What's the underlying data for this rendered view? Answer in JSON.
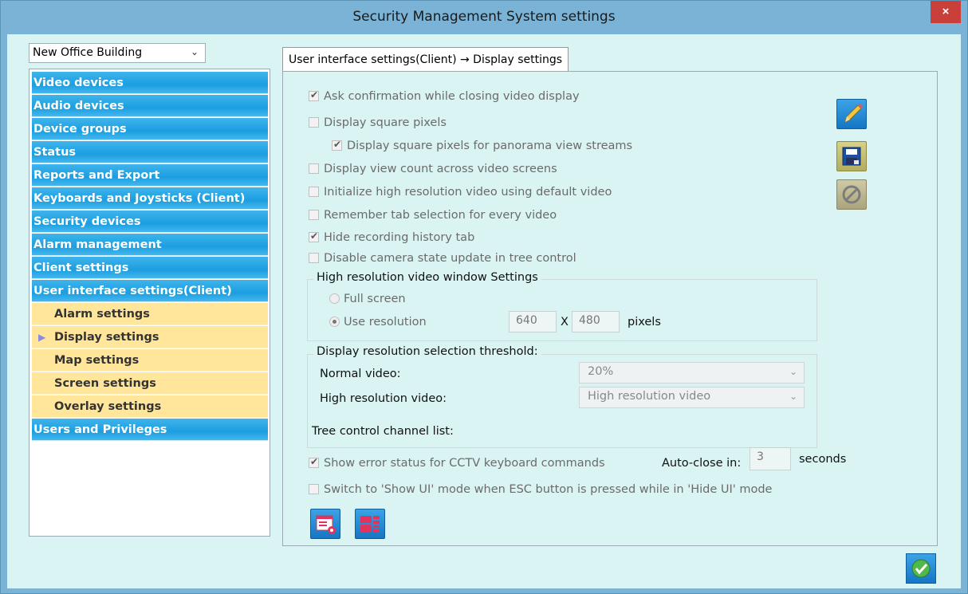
{
  "window": {
    "title": "Security Management System settings",
    "close_label": "×"
  },
  "location_select": {
    "value": "New Office Building"
  },
  "nav": {
    "items": [
      {
        "label": "Video devices"
      },
      {
        "label": "Audio devices"
      },
      {
        "label": "Device groups"
      },
      {
        "label": "Status"
      },
      {
        "label": "Reports and Export"
      },
      {
        "label": "Keyboards and Joysticks (Client)"
      },
      {
        "label": "Security devices"
      },
      {
        "label": "Alarm management"
      },
      {
        "label": "Client settings"
      },
      {
        "label": "User interface settings(Client)"
      }
    ],
    "sub_items": [
      {
        "label": "Alarm settings"
      },
      {
        "label": "Display settings",
        "selected": true
      },
      {
        "label": "Map settings"
      },
      {
        "label": "Screen settings"
      },
      {
        "label": "Overlay settings"
      }
    ],
    "last_item": {
      "label": "Users and Privileges"
    }
  },
  "tab": {
    "label": "User interface settings(Client) → Display settings"
  },
  "options": {
    "ask_confirmation": {
      "label": "Ask confirmation while closing video display",
      "checked": true
    },
    "square_pixels": {
      "label": "Display square pixels",
      "checked": false
    },
    "square_pixels_panorama": {
      "label": "Display square pixels for panorama view streams",
      "checked": true
    },
    "view_count": {
      "label": "Display view count across video screens",
      "checked": false
    },
    "init_high_res": {
      "label": "Initialize high resolution video using default video",
      "checked": false
    },
    "remember_tab": {
      "label": "Remember tab selection for every video",
      "checked": false
    },
    "hide_recording": {
      "label": "Hide recording history tab",
      "checked": true
    },
    "disable_camera_state": {
      "label": "Disable camera state update in tree control",
      "checked": false
    }
  },
  "high_res_group": {
    "title": "High resolution video window Settings",
    "full_screen": "Full screen",
    "use_resolution": "Use resolution",
    "width": "640",
    "x_label": "X",
    "height": "480",
    "unit": "pixels"
  },
  "threshold_group": {
    "title": "Display resolution selection threshold:",
    "normal_label": "Normal video:",
    "normal_value": "20%",
    "high_label": "High resolution video:",
    "high_value": "High resolution video"
  },
  "tree_control_label": "Tree control channel list:",
  "cctv": {
    "label": "Show error status for CCTV keyboard commands",
    "checked": true,
    "autoclose_label": "Auto-close in:",
    "autoclose_value": "3",
    "seconds_label": "seconds"
  },
  "esc_option": {
    "label": "Switch to 'Show UI' mode when ESC button is pressed while in 'Hide UI' mode",
    "checked": false
  }
}
